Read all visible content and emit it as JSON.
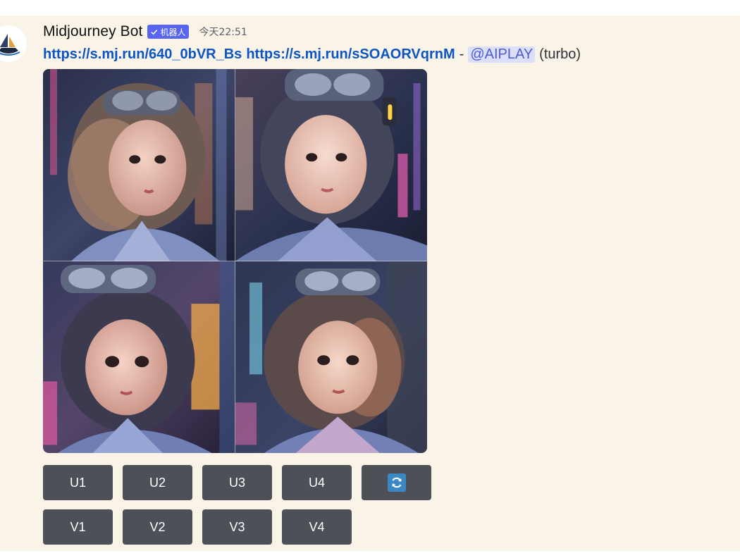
{
  "message": {
    "author": "Midjourney Bot",
    "bot_badge": "机器人",
    "timestamp": "今天22:51",
    "links": [
      "https://s.mj.run/640_0bVR_Bs",
      "https://s.mj.run/sSOAORVqrnM"
    ],
    "separator": "-",
    "mention": "@AIPLAY",
    "mode": "(turbo)"
  },
  "image_grid": {
    "icons": [
      "avatar-icon",
      "verified-check-icon",
      "refresh-icon"
    ]
  },
  "buttons": {
    "upscale": [
      "U1",
      "U2",
      "U3",
      "U4"
    ],
    "variation": [
      "V1",
      "V2",
      "V3",
      "V4"
    ]
  },
  "colors": {
    "background": "#faf3e7",
    "link": "#0b55c4",
    "badge": "#5865f2",
    "mention_bg": "#dcdff9",
    "button": "#4e5058",
    "reroll_accent": "#3b88c3"
  }
}
